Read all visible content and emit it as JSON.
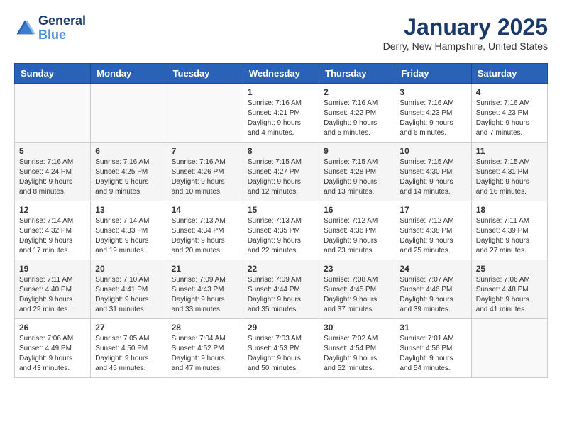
{
  "header": {
    "logo_line1": "General",
    "logo_line2": "Blue",
    "month": "January 2025",
    "location": "Derry, New Hampshire, United States"
  },
  "weekdays": [
    "Sunday",
    "Monday",
    "Tuesday",
    "Wednesday",
    "Thursday",
    "Friday",
    "Saturday"
  ],
  "weeks": [
    [
      {
        "day": "",
        "content": ""
      },
      {
        "day": "",
        "content": ""
      },
      {
        "day": "",
        "content": ""
      },
      {
        "day": "1",
        "content": "Sunrise: 7:16 AM\nSunset: 4:21 PM\nDaylight: 9 hours\nand 4 minutes."
      },
      {
        "day": "2",
        "content": "Sunrise: 7:16 AM\nSunset: 4:22 PM\nDaylight: 9 hours\nand 5 minutes."
      },
      {
        "day": "3",
        "content": "Sunrise: 7:16 AM\nSunset: 4:23 PM\nDaylight: 9 hours\nand 6 minutes."
      },
      {
        "day": "4",
        "content": "Sunrise: 7:16 AM\nSunset: 4:23 PM\nDaylight: 9 hours\nand 7 minutes."
      }
    ],
    [
      {
        "day": "5",
        "content": "Sunrise: 7:16 AM\nSunset: 4:24 PM\nDaylight: 9 hours\nand 8 minutes."
      },
      {
        "day": "6",
        "content": "Sunrise: 7:16 AM\nSunset: 4:25 PM\nDaylight: 9 hours\nand 9 minutes."
      },
      {
        "day": "7",
        "content": "Sunrise: 7:16 AM\nSunset: 4:26 PM\nDaylight: 9 hours\nand 10 minutes."
      },
      {
        "day": "8",
        "content": "Sunrise: 7:15 AM\nSunset: 4:27 PM\nDaylight: 9 hours\nand 12 minutes."
      },
      {
        "day": "9",
        "content": "Sunrise: 7:15 AM\nSunset: 4:28 PM\nDaylight: 9 hours\nand 13 minutes."
      },
      {
        "day": "10",
        "content": "Sunrise: 7:15 AM\nSunset: 4:30 PM\nDaylight: 9 hours\nand 14 minutes."
      },
      {
        "day": "11",
        "content": "Sunrise: 7:15 AM\nSunset: 4:31 PM\nDaylight: 9 hours\nand 16 minutes."
      }
    ],
    [
      {
        "day": "12",
        "content": "Sunrise: 7:14 AM\nSunset: 4:32 PM\nDaylight: 9 hours\nand 17 minutes."
      },
      {
        "day": "13",
        "content": "Sunrise: 7:14 AM\nSunset: 4:33 PM\nDaylight: 9 hours\nand 19 minutes."
      },
      {
        "day": "14",
        "content": "Sunrise: 7:13 AM\nSunset: 4:34 PM\nDaylight: 9 hours\nand 20 minutes."
      },
      {
        "day": "15",
        "content": "Sunrise: 7:13 AM\nSunset: 4:35 PM\nDaylight: 9 hours\nand 22 minutes."
      },
      {
        "day": "16",
        "content": "Sunrise: 7:12 AM\nSunset: 4:36 PM\nDaylight: 9 hours\nand 23 minutes."
      },
      {
        "day": "17",
        "content": "Sunrise: 7:12 AM\nSunset: 4:38 PM\nDaylight: 9 hours\nand 25 minutes."
      },
      {
        "day": "18",
        "content": "Sunrise: 7:11 AM\nSunset: 4:39 PM\nDaylight: 9 hours\nand 27 minutes."
      }
    ],
    [
      {
        "day": "19",
        "content": "Sunrise: 7:11 AM\nSunset: 4:40 PM\nDaylight: 9 hours\nand 29 minutes."
      },
      {
        "day": "20",
        "content": "Sunrise: 7:10 AM\nSunset: 4:41 PM\nDaylight: 9 hours\nand 31 minutes."
      },
      {
        "day": "21",
        "content": "Sunrise: 7:09 AM\nSunset: 4:43 PM\nDaylight: 9 hours\nand 33 minutes."
      },
      {
        "day": "22",
        "content": "Sunrise: 7:09 AM\nSunset: 4:44 PM\nDaylight: 9 hours\nand 35 minutes."
      },
      {
        "day": "23",
        "content": "Sunrise: 7:08 AM\nSunset: 4:45 PM\nDaylight: 9 hours\nand 37 minutes."
      },
      {
        "day": "24",
        "content": "Sunrise: 7:07 AM\nSunset: 4:46 PM\nDaylight: 9 hours\nand 39 minutes."
      },
      {
        "day": "25",
        "content": "Sunrise: 7:06 AM\nSunset: 4:48 PM\nDaylight: 9 hours\nand 41 minutes."
      }
    ],
    [
      {
        "day": "26",
        "content": "Sunrise: 7:06 AM\nSunset: 4:49 PM\nDaylight: 9 hours\nand 43 minutes."
      },
      {
        "day": "27",
        "content": "Sunrise: 7:05 AM\nSunset: 4:50 PM\nDaylight: 9 hours\nand 45 minutes."
      },
      {
        "day": "28",
        "content": "Sunrise: 7:04 AM\nSunset: 4:52 PM\nDaylight: 9 hours\nand 47 minutes."
      },
      {
        "day": "29",
        "content": "Sunrise: 7:03 AM\nSunset: 4:53 PM\nDaylight: 9 hours\nand 50 minutes."
      },
      {
        "day": "30",
        "content": "Sunrise: 7:02 AM\nSunset: 4:54 PM\nDaylight: 9 hours\nand 52 minutes."
      },
      {
        "day": "31",
        "content": "Sunrise: 7:01 AM\nSunset: 4:56 PM\nDaylight: 9 hours\nand 54 minutes."
      },
      {
        "day": "",
        "content": ""
      }
    ]
  ]
}
